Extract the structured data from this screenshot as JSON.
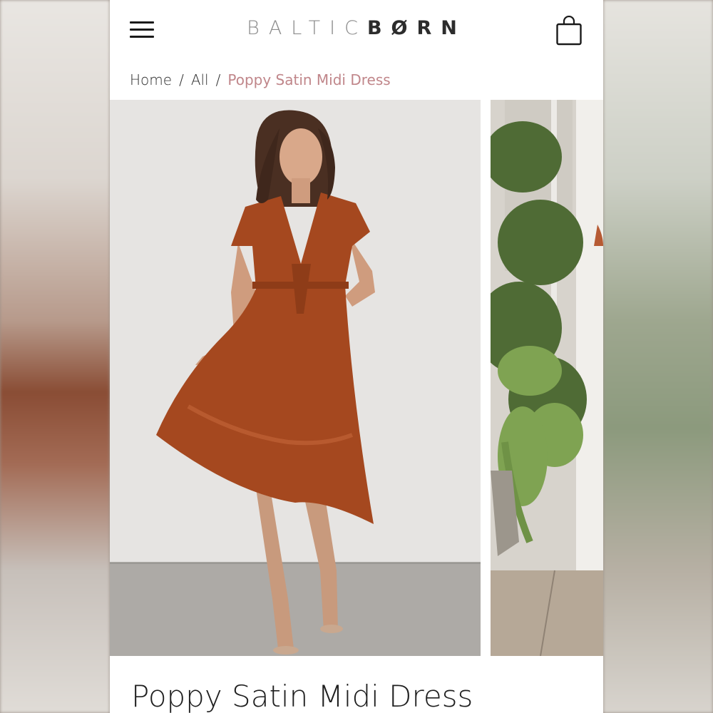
{
  "logo": {
    "part1": "BALTIC",
    "part2": "BØRN"
  },
  "header": {
    "menu_icon": "hamburger-menu-icon",
    "cart_icon": "shopping-bag-icon"
  },
  "breadcrumb": {
    "home": "Home",
    "sep1": "/",
    "all": "All",
    "sep2": "/",
    "current": "Poppy Satin Midi Dress"
  },
  "product": {
    "title": "Poppy Satin Midi Dress"
  },
  "colors": {
    "accent": "#c0868a",
    "dress": "#a5481f",
    "text": "#1f1f1f"
  }
}
